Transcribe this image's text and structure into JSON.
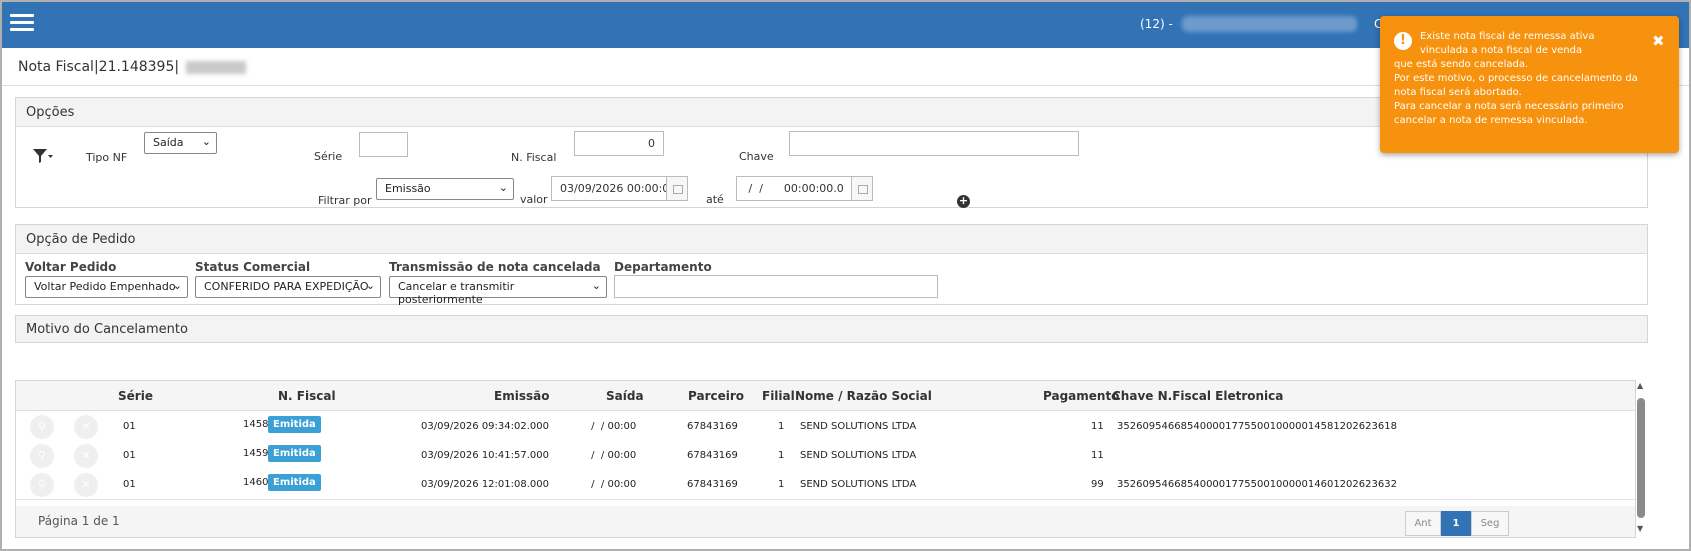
{
  "header": {
    "user_prefix": "(12) -",
    "extra": "C"
  },
  "page": {
    "title": "Nota Fiscal|21.148395|"
  },
  "opcoes": {
    "title": "Opções",
    "tipo_nf_label": "Tipo NF",
    "tipo_nf_value": "Saída",
    "serie_label": "Série",
    "serie_value": "",
    "nfiscal_label": "N. Fiscal",
    "nfiscal_value": "0",
    "chave_label": "Chave",
    "chave_value": "",
    "filtrar_label": "Filtrar por",
    "filtrar_value": "Emissão",
    "valor_label": "valor",
    "valor_value": "03/09/2026 00:00:0",
    "ate_label": "até",
    "ate_value": " /  /      00:00:00.0"
  },
  "pedido": {
    "title": "Opção de Pedido",
    "voltar_label": "Voltar Pedido",
    "voltar_value": "Voltar Pedido Empenhado",
    "status_label": "Status Comercial",
    "status_value": "CONFERIDO PARA EXPEDIÇÃO",
    "transmissao_label": "Transmissão de nota cancelada",
    "transmissao_value": "Cancelar e transmitir posteriormente",
    "departamento_label": "Departamento",
    "departamento_value": ""
  },
  "motivo": {
    "title": "Motivo do Cancelamento"
  },
  "grid": {
    "columns": [
      "Série",
      "N. Fiscal",
      "Emissão",
      "Saída",
      "Parceiro",
      "Filial",
      "Nome / Razão Social",
      "Pagamento",
      "Chave N.Fiscal Eletronica"
    ],
    "rows": [
      {
        "serie": "01",
        "nfiscal": "1458",
        "status": "Emitida",
        "emissao": "03/09/2026 09:34:02.000",
        "saida": " /  / 00:00",
        "parceiro": "67843169",
        "filial": "1",
        "nome": "SEND SOLUTIONS LTDA",
        "pagamento": "11",
        "chave": "35260954668540000177550010000014581202623618"
      },
      {
        "serie": "01",
        "nfiscal": "1459",
        "status": "Emitida",
        "emissao": "03/09/2026 10:41:57.000",
        "saida": " /  / 00:00",
        "parceiro": "67843169",
        "filial": "1",
        "nome": "SEND SOLUTIONS LTDA",
        "pagamento": "11",
        "chave": ""
      },
      {
        "serie": "01",
        "nfiscal": "1460",
        "status": "Emitida",
        "emissao": "03/09/2026 12:01:08.000",
        "saida": " /  / 00:00",
        "parceiro": "67843169",
        "filial": "1",
        "nome": "SEND SOLUTIONS LTDA",
        "pagamento": "99",
        "chave": "35260954668540000177550010000014601202623632"
      }
    ],
    "pagination": {
      "info": "Página 1 de 1",
      "prev": "Ant",
      "current": "1",
      "next": "Seg"
    }
  },
  "toast": {
    "lines": [
      "Existe nota fiscal de remessa ativa",
      "vinculada a nota fiscal de venda",
      "que está sendo cancelada.",
      "Por este motivo, o processo de cancelamento da",
      "nota fiscal será abortado.",
      "Para cancelar a nota será necessário primeiro",
      "cancelar a nota de remessa vinculada."
    ]
  },
  "colors": {
    "header": "#3173b5",
    "toast": "#f7920e",
    "badge": "#3aa0d6"
  },
  "icons": [
    "menu-icon",
    "filter-icon",
    "calendar-icon",
    "plus-circle-icon",
    "search-icon",
    "cancel-x-icon",
    "warning-icon",
    "close-icon"
  ]
}
